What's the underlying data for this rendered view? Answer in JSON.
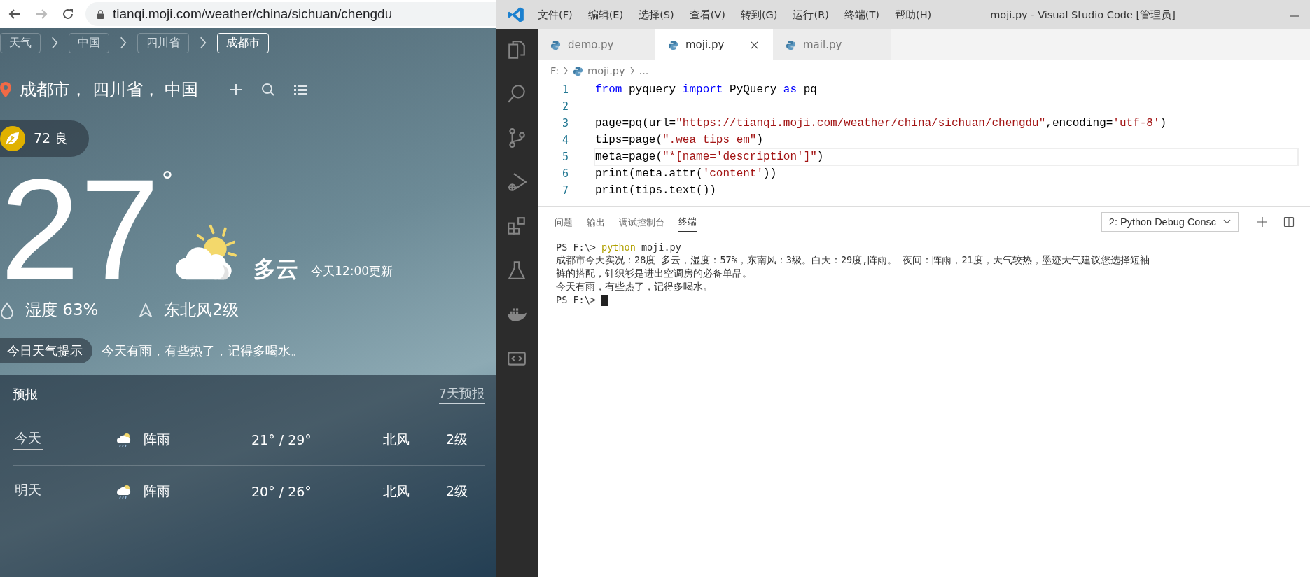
{
  "browser": {
    "url": "tianqi.moji.com/weather/china/sichuan/chengdu"
  },
  "weather": {
    "breadcrumbs": [
      {
        "label": "天气",
        "selected": false
      },
      {
        "label": "中国",
        "selected": false
      },
      {
        "label": "四川省",
        "selected": false
      },
      {
        "label": "成都市",
        "selected": true
      }
    ],
    "location": "成都市， 四川省， 中国",
    "aqi": "72 良",
    "temperature": "27",
    "degree": "°",
    "condition": "多云",
    "updated": "今天12:00更新",
    "humidity": "湿度 63%",
    "wind": "东北风2级",
    "tip": {
      "label": "今日天气提示",
      "text": "今天有雨，有些热了，记得多喝水。"
    },
    "forecast": {
      "title": "预报",
      "link": "7天预报",
      "rows": [
        {
          "day": "今天",
          "condition": "阵雨",
          "temp": "21° / 29°",
          "wind": "北风",
          "level": "2级"
        },
        {
          "day": "明天",
          "condition": "阵雨",
          "temp": "20° / 26°",
          "wind": "北风",
          "level": "2级"
        }
      ]
    }
  },
  "vscode": {
    "menu": [
      "文件(F)",
      "编辑(E)",
      "选择(S)",
      "查看(V)",
      "转到(G)",
      "运行(R)",
      "终端(T)",
      "帮助(H)"
    ],
    "title": "moji.py - Visual Studio Code [管理员]",
    "tabs": [
      {
        "label": "demo.py",
        "selected": false
      },
      {
        "label": "moji.py",
        "selected": true
      },
      {
        "label": "mail.py",
        "selected": false
      }
    ],
    "breadcrumb": [
      "F:",
      "moji.py",
      "..."
    ],
    "code": [
      {
        "number": "1",
        "current": false,
        "tokens": [
          {
            "kind": "kw",
            "text": "from"
          },
          {
            "kind": "plain",
            "text": " pyquery "
          },
          {
            "kind": "kw",
            "text": "import"
          },
          {
            "kind": "plain",
            "text": " PyQuery "
          },
          {
            "kind": "kw",
            "text": "as"
          },
          {
            "kind": "plain",
            "text": " pq"
          }
        ]
      },
      {
        "number": "2",
        "current": false
      },
      {
        "number": "3",
        "current": false,
        "tokens": [
          {
            "kind": "plain",
            "text": "page=pq(url="
          },
          {
            "kind": "str",
            "text": "\""
          },
          {
            "kind": "link",
            "text": "https://tianqi.moji.com/weather/china/sichuan/chengdu"
          },
          {
            "kind": "str",
            "text": "\""
          },
          {
            "kind": "plain",
            "text": ",encoding="
          },
          {
            "kind": "str",
            "text": "'utf-8'"
          },
          {
            "kind": "plain",
            "text": ")"
          }
        ]
      },
      {
        "number": "4",
        "current": false,
        "tokens": [
          {
            "kind": "plain",
            "text": "tips=page("
          },
          {
            "kind": "str",
            "text": "\".wea_tips em\""
          },
          {
            "kind": "plain",
            "text": ")"
          }
        ]
      },
      {
        "number": "5",
        "current": true,
        "tokens": [
          {
            "kind": "plain",
            "text": "meta=page("
          },
          {
            "kind": "str",
            "text": "\"*[name='description']\""
          },
          {
            "kind": "plain",
            "text": ")"
          }
        ]
      },
      {
        "number": "6",
        "current": false,
        "tokens": [
          {
            "kind": "plain",
            "text": "print(meta.attr("
          },
          {
            "kind": "str",
            "text": "'content'"
          },
          {
            "kind": "plain",
            "text": "))"
          }
        ]
      },
      {
        "number": "7",
        "current": false,
        "tokens": [
          {
            "kind": "plain",
            "text": "print(tips.text())"
          }
        ]
      }
    ],
    "panel_tabs": [
      {
        "label": "问题",
        "selected": false
      },
      {
        "label": "输出",
        "selected": false
      },
      {
        "label": "调试控制台",
        "selected": false
      },
      {
        "label": "终端",
        "selected": true
      }
    ],
    "terminal_select": "2: Python Debug Consc",
    "terminal": [
      [
        {
          "kind": "out",
          "text": "PS F:\\> "
        },
        {
          "kind": "cmd",
          "text": "python"
        },
        {
          "kind": "out",
          "text": " moji.py"
        }
      ],
      [
        {
          "kind": "out",
          "text": "成都市今天实况：28度 多云，湿度：57%，东南风：3级。白天：29度,阵雨。 夜间：阵雨，21度，天气较热，墨迹天气建议您选择短袖"
        }
      ],
      [
        {
          "kind": "out",
          "text": "裤的搭配，针织衫是进出空调房的必备单品。"
        }
      ],
      [
        {
          "kind": "out",
          "text": "今天有雨，有些热了，记得多喝水。"
        }
      ],
      [
        {
          "kind": "out",
          "text": "PS F:\\> "
        },
        {
          "kind": "cursor"
        }
      ]
    ]
  }
}
